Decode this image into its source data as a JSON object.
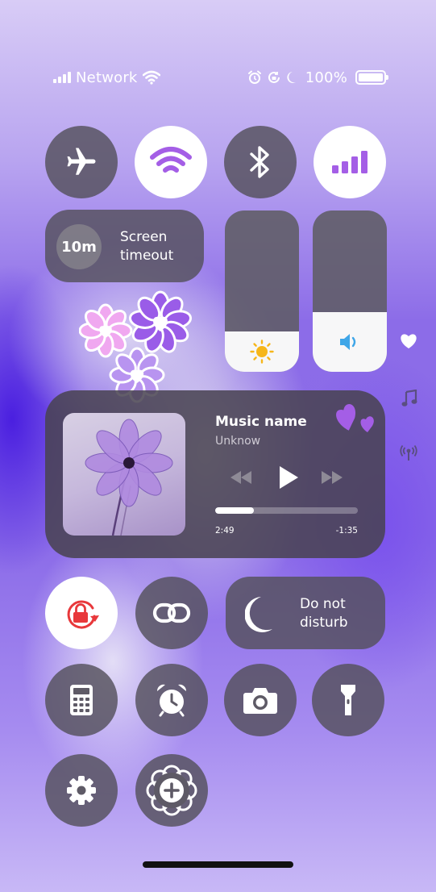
{
  "status_bar": {
    "network_label": "Network",
    "battery_percent": "100%",
    "icons": [
      "signal-bars-icon",
      "wifi-icon",
      "alarm-icon",
      "rotation-lock-icon",
      "moon-icon",
      "battery-icon"
    ]
  },
  "toggles": [
    {
      "name": "airplane-mode",
      "icon": "airplane-icon",
      "active": false
    },
    {
      "name": "wifi",
      "icon": "wifi-icon",
      "active": true
    },
    {
      "name": "bluetooth",
      "icon": "bluetooth-icon",
      "active": false
    },
    {
      "name": "mobile-data",
      "icon": "cellular-icon",
      "active": true
    }
  ],
  "screen_timeout": {
    "value": "10m",
    "label": "Screen timeout"
  },
  "sliders": {
    "brightness": {
      "icon": "sun-icon",
      "level": 0.25
    },
    "volume": {
      "icon": "speaker-icon",
      "level": 0.37
    }
  },
  "side_icons": [
    "heart-icon",
    "music-note-icon",
    "broadcast-icon"
  ],
  "media": {
    "title": "Music name",
    "artist": "Unknow",
    "elapsed": "2:49",
    "remaining": "-1:35",
    "progress": 0.27,
    "controls": [
      "rewind-icon",
      "play-icon",
      "fast-forward-icon"
    ]
  },
  "do_not_disturb": {
    "label": "Do not disturb",
    "icon": "moon-icon"
  },
  "shortcuts": [
    "rotation-lock-icon",
    "link-icon",
    "calculator-icon",
    "alarm-clock-icon",
    "camera-icon",
    "flashlight-icon",
    "settings-icon",
    "add-icon"
  ],
  "colors": {
    "accent": "#a45ee6",
    "rotation_lock": "#e8383b",
    "sun": "#f6b61a",
    "speaker": "#3fa6e8"
  }
}
